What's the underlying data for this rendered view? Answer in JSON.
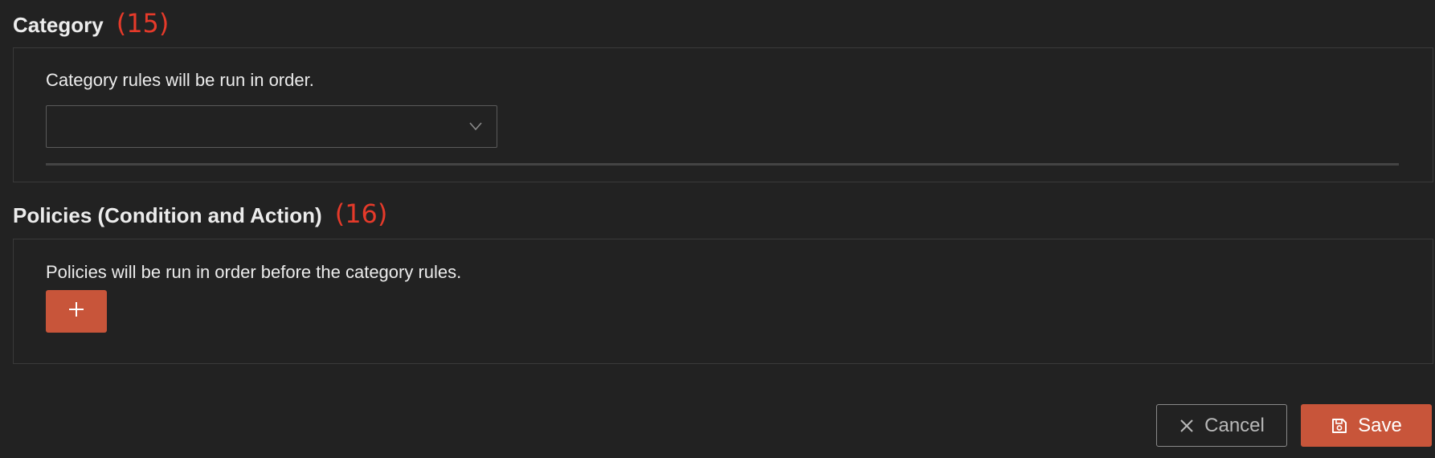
{
  "category": {
    "title": "Category",
    "annotation": "(15)",
    "description": "Category rules will be run in order.",
    "select_value": "",
    "chevron_icon": "chevron-down-icon"
  },
  "policies": {
    "title": "Policies (Condition and Action)",
    "annotation": "(16)",
    "description": "Policies will be run in order before the category rules.",
    "add_icon": "plus-icon"
  },
  "footer": {
    "cancel_label": "Cancel",
    "cancel_icon": "close-icon",
    "save_label": "Save",
    "save_icon": "save-icon"
  },
  "colors": {
    "background": "#222222",
    "accent": "#c8553a",
    "annotation": "#e53a2a",
    "border": "#3a3a3a"
  }
}
